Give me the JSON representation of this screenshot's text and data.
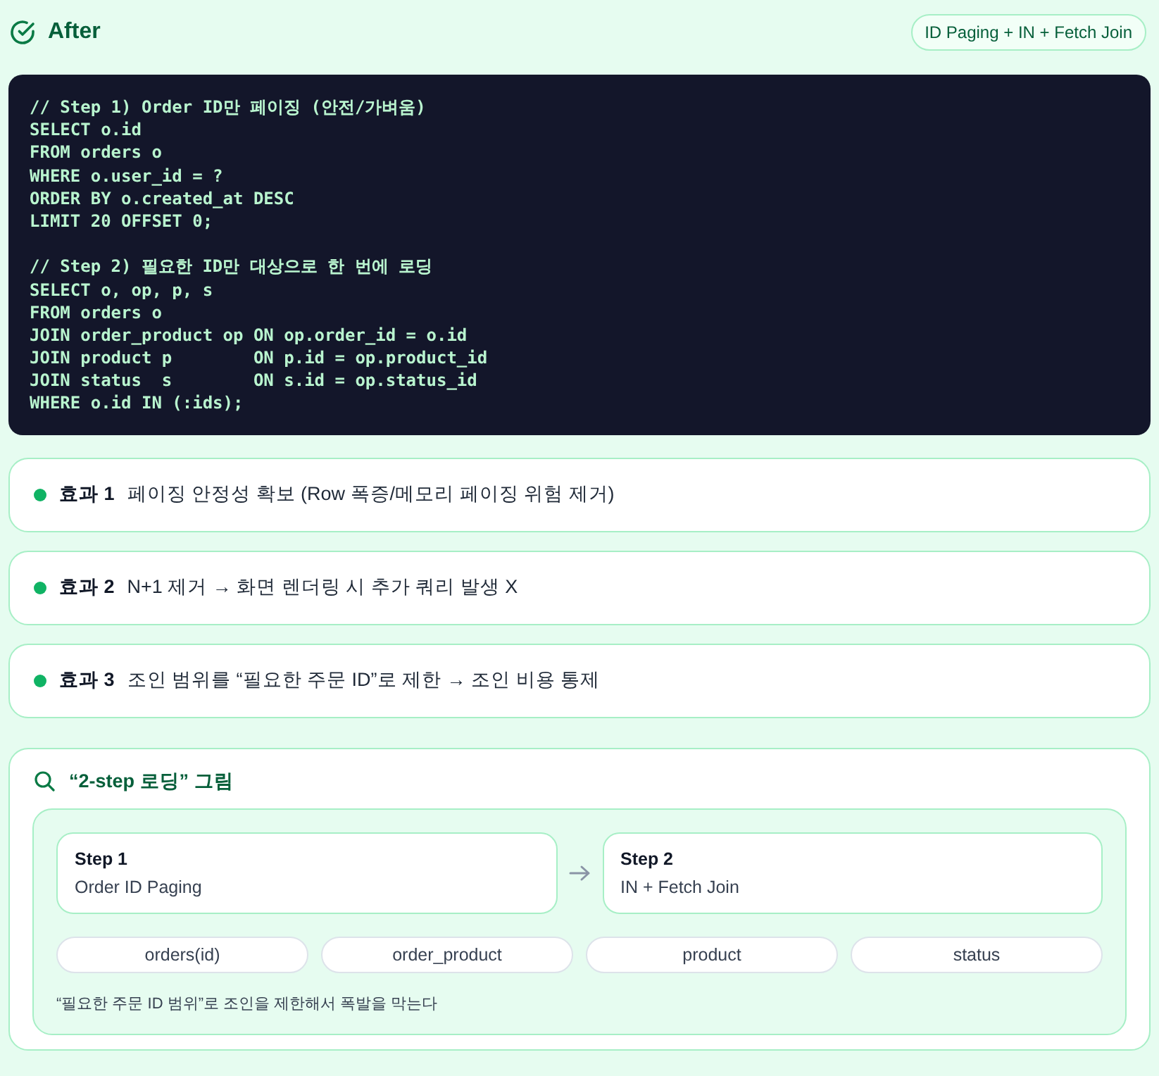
{
  "header": {
    "title": "After",
    "badge": "ID Paging + IN + Fetch Join"
  },
  "code": [
    [
      "// Step 1) Order ID만 페이징 (안전/가벼움)",
      "SELECT o.id",
      "FROM orders o",
      "WHERE o.user_id = ?",
      "ORDER BY o.created_at DESC",
      "LIMIT 20 OFFSET 0;"
    ],
    [
      "// Step 2) 필요한 ID만 대상으로 한 번에 로딩",
      "SELECT o, op, p, s",
      "FROM orders o",
      "JOIN order_product op ON op.order_id = o.id",
      "JOIN product p        ON p.id = op.product_id",
      "JOIN status  s        ON s.id = op.status_id",
      "WHERE o.id IN (:ids);"
    ]
  ],
  "effects": [
    {
      "label": "효과 1",
      "text": "페이징 안정성 확보 (Row 폭증/메모리 페이징 위험 제거)"
    },
    {
      "label": "효과 2",
      "text": "N+1 제거 → 화면 렌더링 시 추가 쿼리 발생 X"
    },
    {
      "label": "효과 3",
      "text": "조인 범위를 “필요한 주문 ID”로 제한 → 조인 비용 통제"
    }
  ],
  "diagram": {
    "title": "“2-step 로딩” 그림",
    "steps": [
      {
        "title": "Step 1",
        "subtitle": "Order ID Paging"
      },
      {
        "title": "Step 2",
        "subtitle": "IN + Fetch Join"
      }
    ],
    "tables": [
      "orders(id)",
      "order_product",
      "product",
      "status"
    ],
    "caption": "“필요한 주문 ID 범위”로 조인을 제한해서 폭발을 막는다"
  }
}
